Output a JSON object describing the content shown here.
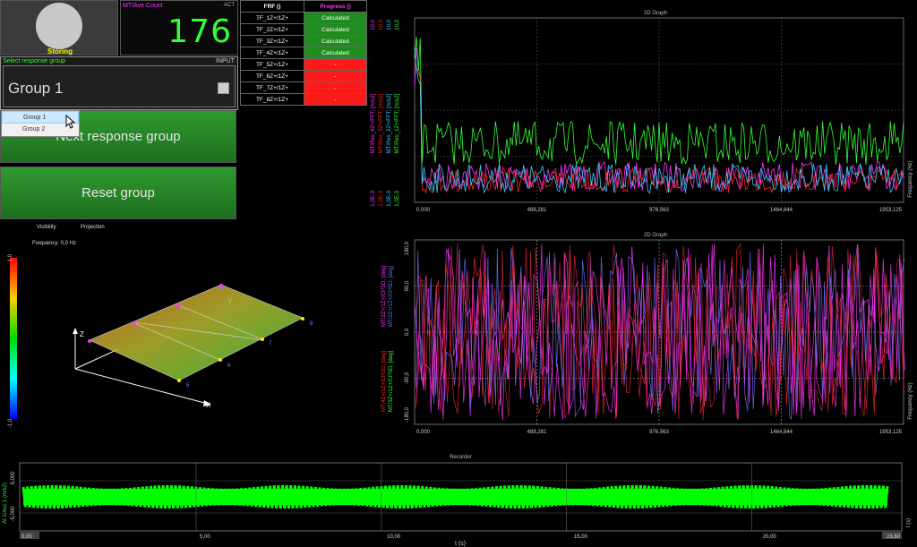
{
  "storing": {
    "label": "Storing"
  },
  "counter": {
    "title": "MT/Ave Count",
    "mode": "ACT",
    "value": "176"
  },
  "response_group": {
    "title": "Select response group",
    "tag": "INPUT",
    "value": "Group 1",
    "options": [
      "Group 1",
      "Group 2"
    ]
  },
  "buttons": {
    "next": "Next response group",
    "reset": "Reset group"
  },
  "labels": {
    "visibility": "Visibility",
    "projection": "Projection",
    "frequency": "Frequency: 0,0 Hz"
  },
  "frf_table": {
    "headers": [
      "FRF ()",
      "Progress ()"
    ],
    "rows": [
      {
        "name": "TF_1Z+/1Z+",
        "status": "Calculated"
      },
      {
        "name": "TF_2Z+/1Z+",
        "status": "Calculated"
      },
      {
        "name": "TF_3Z+/1Z+",
        "status": "Calculated"
      },
      {
        "name": "TF_4Z+/1Z+",
        "status": "Calculated"
      },
      {
        "name": "TF_5Z+/1Z+",
        "status": "-"
      },
      {
        "name": "TF_6Z+/1Z+",
        "status": "-"
      },
      {
        "name": "TF_7Z+/1Z+",
        "status": "-"
      },
      {
        "name": "TF_8Z+/1Z+",
        "status": "-"
      }
    ]
  },
  "graph1": {
    "title": "2D Graph",
    "x_ticks": [
      "0,000",
      "488,281",
      "976,563",
      "1464,844",
      "1953,125"
    ],
    "x_label": "Frequency (Hz)",
    "y_top": "10,0",
    "y_bottom": "1,0E-3",
    "series": [
      {
        "name": "MT/Res_4Z+/FFT; [m/s2]",
        "color": "#ff33ff"
      },
      {
        "name": "MT/Res_3Z+/FFT; [m/s2]",
        "color": "#ff2222"
      },
      {
        "name": "MT/Res_2Z+/FFT; [m/s2]",
        "color": "#33ccff"
      },
      {
        "name": "MT/Res_1Z+/FFT; [m/s2]",
        "color": "#33ff33"
      }
    ]
  },
  "graph2": {
    "title": "2D Graph",
    "x_ticks": [
      "0,000",
      "488,281",
      "976,563",
      "1464,844",
      "1953,125"
    ],
    "x_label": "Frequency (Hz)",
    "y_ticks": [
      "180,0",
      "90,0",
      "0,0",
      "-90,0",
      "-180,0"
    ],
    "series": [
      {
        "name": "MT/2Z+/1Z+/CPSD; [deg]",
        "color": "#ff33ff"
      },
      {
        "name": "MT/2Z+/1Z+/CPSD; [deg]",
        "color": "#7070ff"
      },
      {
        "name": "MT/4Z+/1Z+/CPSD; [deg]",
        "color": "#ff2222"
      },
      {
        "name": "MT/3Z+/1Z+/CPSD; [deg]",
        "color": "#33ff33"
      }
    ]
  },
  "model3d": {
    "scale_top": "1,0",
    "scale_bottom": "-1,0",
    "axes": [
      "Z",
      "X",
      "Y"
    ],
    "nodes": [
      "1",
      "2",
      "3",
      "4",
      "5",
      "6",
      "7",
      "8"
    ]
  },
  "recorder": {
    "title": "Recorder",
    "y_label": "AI 1/Acc 1 (m/s2)",
    "y_ticks": [
      "5,000",
      "-5,000"
    ],
    "x_ticks": [
      "0,00",
      "5,00",
      "10,00",
      "15,00",
      "20,00",
      "23,60"
    ],
    "x_label": "t (s)",
    "right_label": "t (s)"
  },
  "colors": {
    "accent_green": "#33ff33",
    "accent_magenta": "#ff33ff",
    "button_green": "#2a8a2a",
    "alert_red": "#ff1a1a"
  }
}
